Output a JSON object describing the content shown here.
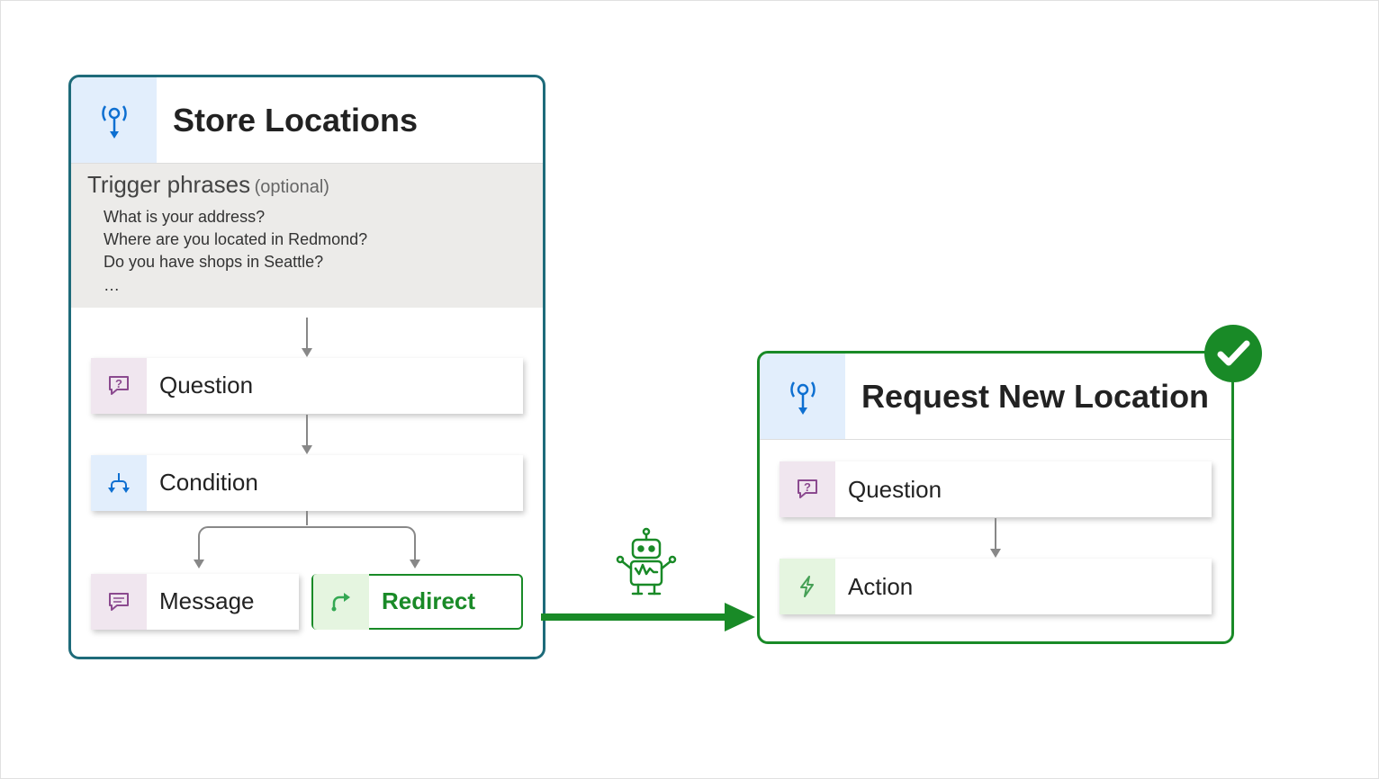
{
  "topics": {
    "left": {
      "title": "Store Locations",
      "trigger_label": "Trigger phrases",
      "trigger_optional": "(optional)",
      "phrases": [
        "What is your address?",
        "Where are you located in Redmond?",
        "Do you have shops in Seattle?",
        "…"
      ],
      "nodes": {
        "question": "Question",
        "condition": "Condition",
        "message": "Message",
        "redirect": "Redirect"
      }
    },
    "right": {
      "title": "Request New Location",
      "nodes": {
        "question": "Question",
        "action": "Action"
      }
    }
  }
}
